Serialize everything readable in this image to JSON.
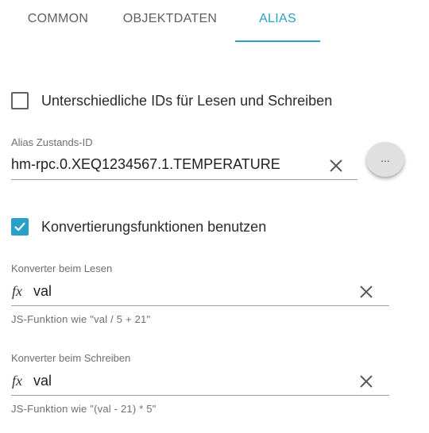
{
  "tabs": [
    {
      "label": "COMMON",
      "active": false
    },
    {
      "label": "OBJEKTDATEN",
      "active": false
    },
    {
      "label": "ALIAS",
      "active": true
    }
  ],
  "accent_color": "#2aa0c8",
  "separate_ids": {
    "label": "Unterschiedliche IDs für Lesen und Schreiben",
    "checked": false
  },
  "alias_id": {
    "label": "Alias Zustands-ID",
    "value": "hm-rpc.0.XEQ1234567.1.TEMPERATURE",
    "clear_icon": "close-icon",
    "more_label": "..."
  },
  "use_conversion": {
    "label": "Konvertierungsfunktionen benutzen",
    "checked": true
  },
  "read_converter": {
    "label": "Konverter beim Lesen",
    "prefix": "fx",
    "value": "val",
    "helper": "JS-Funktion wie \"val / 5 + 21\""
  },
  "write_converter": {
    "label": "Konverter beim Schreiben",
    "prefix": "fx",
    "value": "val",
    "helper": "JS-Funktion wie \"(val - 21) * 5\""
  }
}
